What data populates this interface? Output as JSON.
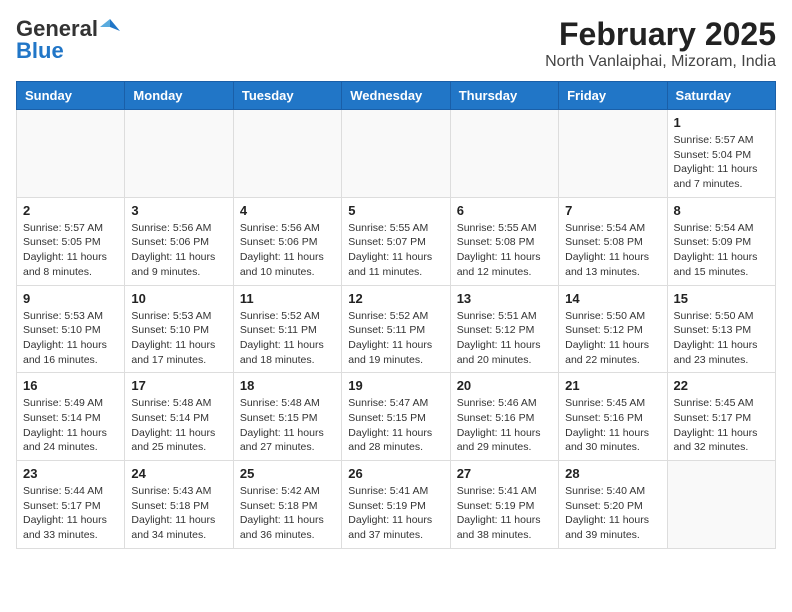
{
  "header": {
    "logo_general": "General",
    "logo_blue": "Blue",
    "title": "February 2025",
    "subtitle": "North Vanlaiphai, Mizoram, India"
  },
  "weekdays": [
    "Sunday",
    "Monday",
    "Tuesday",
    "Wednesday",
    "Thursday",
    "Friday",
    "Saturday"
  ],
  "weeks": [
    [
      {
        "day": "",
        "info": ""
      },
      {
        "day": "",
        "info": ""
      },
      {
        "day": "",
        "info": ""
      },
      {
        "day": "",
        "info": ""
      },
      {
        "day": "",
        "info": ""
      },
      {
        "day": "",
        "info": ""
      },
      {
        "day": "1",
        "info": "Sunrise: 5:57 AM\nSunset: 5:04 PM\nDaylight: 11 hours and 7 minutes."
      }
    ],
    [
      {
        "day": "2",
        "info": "Sunrise: 5:57 AM\nSunset: 5:05 PM\nDaylight: 11 hours and 8 minutes."
      },
      {
        "day": "3",
        "info": "Sunrise: 5:56 AM\nSunset: 5:06 PM\nDaylight: 11 hours and 9 minutes."
      },
      {
        "day": "4",
        "info": "Sunrise: 5:56 AM\nSunset: 5:06 PM\nDaylight: 11 hours and 10 minutes."
      },
      {
        "day": "5",
        "info": "Sunrise: 5:55 AM\nSunset: 5:07 PM\nDaylight: 11 hours and 11 minutes."
      },
      {
        "day": "6",
        "info": "Sunrise: 5:55 AM\nSunset: 5:08 PM\nDaylight: 11 hours and 12 minutes."
      },
      {
        "day": "7",
        "info": "Sunrise: 5:54 AM\nSunset: 5:08 PM\nDaylight: 11 hours and 13 minutes."
      },
      {
        "day": "8",
        "info": "Sunrise: 5:54 AM\nSunset: 5:09 PM\nDaylight: 11 hours and 15 minutes."
      }
    ],
    [
      {
        "day": "9",
        "info": "Sunrise: 5:53 AM\nSunset: 5:10 PM\nDaylight: 11 hours and 16 minutes."
      },
      {
        "day": "10",
        "info": "Sunrise: 5:53 AM\nSunset: 5:10 PM\nDaylight: 11 hours and 17 minutes."
      },
      {
        "day": "11",
        "info": "Sunrise: 5:52 AM\nSunset: 5:11 PM\nDaylight: 11 hours and 18 minutes."
      },
      {
        "day": "12",
        "info": "Sunrise: 5:52 AM\nSunset: 5:11 PM\nDaylight: 11 hours and 19 minutes."
      },
      {
        "day": "13",
        "info": "Sunrise: 5:51 AM\nSunset: 5:12 PM\nDaylight: 11 hours and 20 minutes."
      },
      {
        "day": "14",
        "info": "Sunrise: 5:50 AM\nSunset: 5:12 PM\nDaylight: 11 hours and 22 minutes."
      },
      {
        "day": "15",
        "info": "Sunrise: 5:50 AM\nSunset: 5:13 PM\nDaylight: 11 hours and 23 minutes."
      }
    ],
    [
      {
        "day": "16",
        "info": "Sunrise: 5:49 AM\nSunset: 5:14 PM\nDaylight: 11 hours and 24 minutes."
      },
      {
        "day": "17",
        "info": "Sunrise: 5:48 AM\nSunset: 5:14 PM\nDaylight: 11 hours and 25 minutes."
      },
      {
        "day": "18",
        "info": "Sunrise: 5:48 AM\nSunset: 5:15 PM\nDaylight: 11 hours and 27 minutes."
      },
      {
        "day": "19",
        "info": "Sunrise: 5:47 AM\nSunset: 5:15 PM\nDaylight: 11 hours and 28 minutes."
      },
      {
        "day": "20",
        "info": "Sunrise: 5:46 AM\nSunset: 5:16 PM\nDaylight: 11 hours and 29 minutes."
      },
      {
        "day": "21",
        "info": "Sunrise: 5:45 AM\nSunset: 5:16 PM\nDaylight: 11 hours and 30 minutes."
      },
      {
        "day": "22",
        "info": "Sunrise: 5:45 AM\nSunset: 5:17 PM\nDaylight: 11 hours and 32 minutes."
      }
    ],
    [
      {
        "day": "23",
        "info": "Sunrise: 5:44 AM\nSunset: 5:17 PM\nDaylight: 11 hours and 33 minutes."
      },
      {
        "day": "24",
        "info": "Sunrise: 5:43 AM\nSunset: 5:18 PM\nDaylight: 11 hours and 34 minutes."
      },
      {
        "day": "25",
        "info": "Sunrise: 5:42 AM\nSunset: 5:18 PM\nDaylight: 11 hours and 36 minutes."
      },
      {
        "day": "26",
        "info": "Sunrise: 5:41 AM\nSunset: 5:19 PM\nDaylight: 11 hours and 37 minutes."
      },
      {
        "day": "27",
        "info": "Sunrise: 5:41 AM\nSunset: 5:19 PM\nDaylight: 11 hours and 38 minutes."
      },
      {
        "day": "28",
        "info": "Sunrise: 5:40 AM\nSunset: 5:20 PM\nDaylight: 11 hours and 39 minutes."
      },
      {
        "day": "",
        "info": ""
      }
    ]
  ]
}
